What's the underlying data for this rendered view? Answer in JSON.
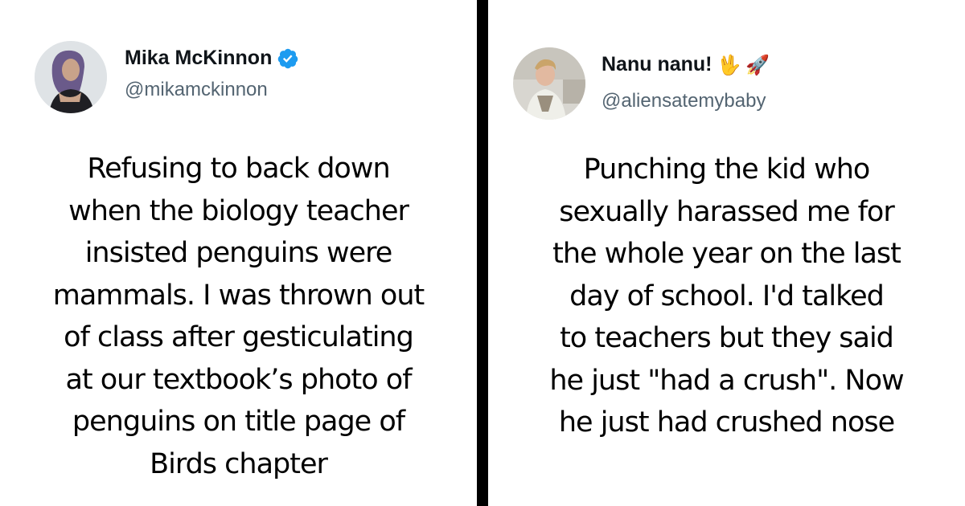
{
  "left_tweet": {
    "display_name": "Mika McKinnon",
    "verified_icon": "verified-badge-icon",
    "handle": "@mikamckinnon",
    "text_lines": [
      "Refusing to back down",
      "when the biology teacher",
      "insisted penguins were",
      "mammals. I was thrown out",
      "of class after gesticulating",
      "at our textbook’s photo of",
      "penguins on title page of",
      "Birds chapter"
    ]
  },
  "right_tweet": {
    "display_name": "Nanu nanu!",
    "name_emojis": [
      "🖖",
      "🚀"
    ],
    "handle": "@aliensatemybaby",
    "text_lines": [
      "Punching the kid who",
      "sexually harassed me for",
      "the whole year on the last",
      "day of school. I'd talked",
      "to teachers but they said",
      "he just \"had a crush\". Now",
      "he just had crushed nose"
    ]
  },
  "colors": {
    "background": "#ffffff",
    "divider": "#000000",
    "name": "#0f1419",
    "handle": "#536471",
    "verified": "#1d9bf0"
  }
}
